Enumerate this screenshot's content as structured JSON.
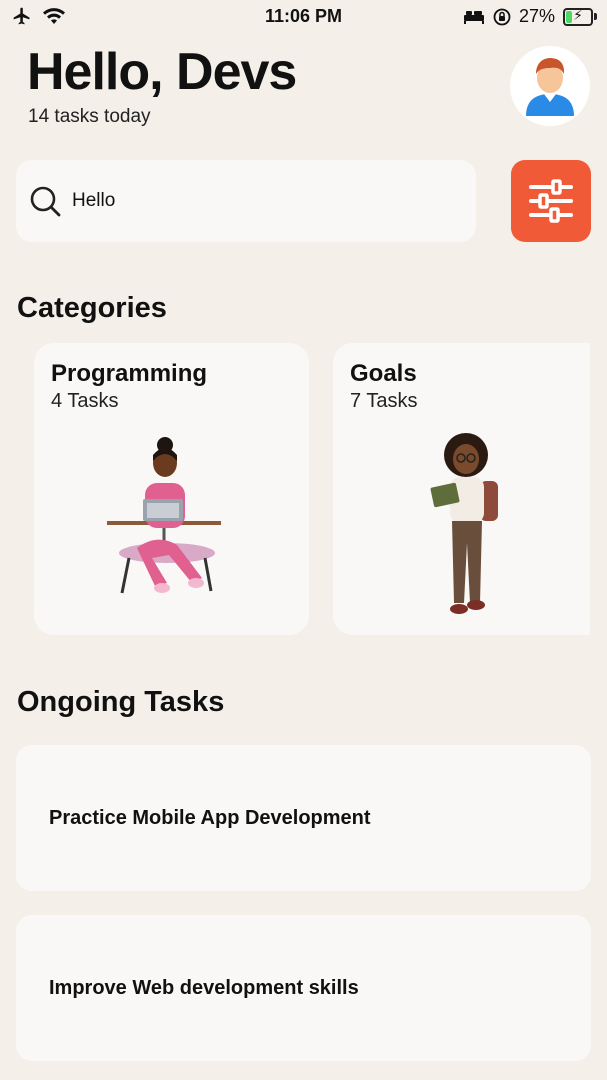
{
  "status_bar": {
    "time": "11:06 PM",
    "battery_percent": "27%",
    "battery_level": 0.27,
    "icons": [
      "airplane-icon",
      "wifi-icon",
      "bed-icon",
      "orientation-lock-icon",
      "battery-icon"
    ]
  },
  "header": {
    "greeting": "Hello, Devs",
    "subtitle": "14 tasks today"
  },
  "search": {
    "value": "Hello"
  },
  "categories": {
    "title": "Categories",
    "items": [
      {
        "title": "Programming",
        "count": "4 Tasks"
      },
      {
        "title": "Goals",
        "count": "7 Tasks"
      }
    ]
  },
  "ongoing": {
    "title": "Ongoing Tasks",
    "items": [
      {
        "title": "Practice Mobile App Development"
      },
      {
        "title": "Improve Web development skills"
      }
    ]
  },
  "colors": {
    "background": "#f5efe9",
    "card": "#faf8f6",
    "accent": "#f05a37"
  }
}
